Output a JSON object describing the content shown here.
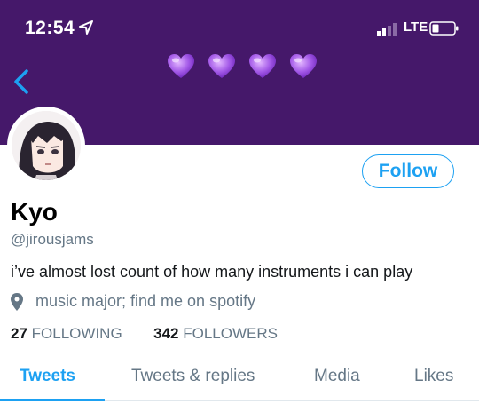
{
  "status_bar": {
    "time": "12:54",
    "network": "LTE"
  },
  "header": {
    "background_color": "#45186a",
    "hearts": [
      "purple-heart",
      "purple-heart",
      "purple-heart",
      "purple-heart"
    ]
  },
  "profile": {
    "follow_label": "Follow",
    "name": "Kyo",
    "handle": "@jirousjams",
    "bio": "i’ve almost lost count of how many instruments i can play",
    "location": "music major; find me on spotify",
    "following_count": "27",
    "following_label": "FOLLOWING",
    "followers_count": "342",
    "followers_label": "FOLLOWERS"
  },
  "tabs": [
    {
      "label": "Tweets",
      "active": true
    },
    {
      "label": "Tweets & replies",
      "active": false
    },
    {
      "label": "Media",
      "active": false
    },
    {
      "label": "Likes",
      "active": false
    }
  ],
  "colors": {
    "accent": "#1da1f2",
    "muted": "#657786"
  }
}
